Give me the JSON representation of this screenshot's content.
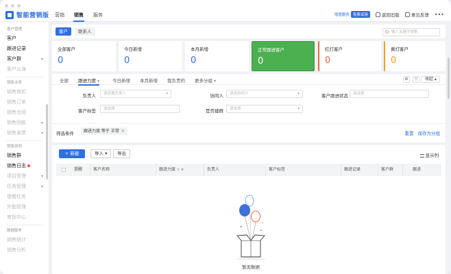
{
  "app": {
    "name": "智能营销版"
  },
  "topnav": {
    "items": [
      {
        "label": "营销"
      },
      {
        "label": "销售"
      },
      {
        "label": "服务"
      }
    ]
  },
  "topright": {
    "version_label": "增值服务",
    "version_badge": "免费试用",
    "switch_label": "返回旧版",
    "feedback_label": "意见反馈",
    "more": "•••"
  },
  "sidebar": {
    "groups": [
      {
        "title": "客户管理",
        "items": [
          {
            "label": "客户",
            "dim": false
          },
          {
            "label": "跟进记录",
            "dim": false
          },
          {
            "label": "客户群",
            "dim": false,
            "chev": true
          },
          {
            "label": "客户公海",
            "dim": true
          }
        ]
      },
      {
        "title": "销售业务",
        "items": [
          {
            "label": "销售商机",
            "dim": true
          },
          {
            "label": "销售订单",
            "dim": true
          },
          {
            "label": "销售合同",
            "dim": true
          },
          {
            "label": "销售回款",
            "dim": true,
            "chev": true
          },
          {
            "label": "销售发票",
            "dim": true,
            "chev": true
          }
        ]
      },
      {
        "title": "销售协同",
        "items": [
          {
            "label": "销售群",
            "dim": false
          },
          {
            "label": "销售日志",
            "dim": false,
            "dot": true
          },
          {
            "label": "项目管理",
            "dim": true,
            "chev": true
          },
          {
            "label": "任务管理",
            "dim": true,
            "chev": true
          },
          {
            "label": "提醒任务",
            "dim": true
          },
          {
            "label": "外勤管理",
            "dim": true
          },
          {
            "label": "审批中心",
            "dim": true
          }
        ]
      },
      {
        "title": "数据服务",
        "items": [
          {
            "label": "销售统计",
            "dim": true
          },
          {
            "label": "销售分析",
            "dim": true
          }
        ]
      }
    ]
  },
  "subtabs": {
    "active": "客户",
    "other": "联系人",
    "search_placeholder": "输入关键字搜索"
  },
  "cards": [
    {
      "label": "全部客户",
      "value": "0"
    },
    {
      "label": "今日新增",
      "value": "0"
    },
    {
      "label": "本月新增",
      "value": "0"
    },
    {
      "label": "正常跟进客户",
      "value": "0"
    },
    {
      "label": "红灯客户",
      "value": "0"
    },
    {
      "label": "黄灯客户",
      "value": "0"
    }
  ],
  "filter_tabs": {
    "items": [
      "全部",
      "跟进力度",
      "今日新增",
      "本月新增",
      "我负责的",
      "更多分组"
    ],
    "collapse": "收起"
  },
  "filters": {
    "owner_label": "负责人",
    "owner_placeholder": "请设置负责人",
    "collab_label": "协同人",
    "collab_placeholder": "请选协同人",
    "status_label": "客户跟进状态",
    "status_placeholder": "请选择",
    "tag_label": "客户标签",
    "tag_placeholder": "请选择",
    "group_label": "是否建群",
    "group_placeholder": "请选择"
  },
  "filter_bar": {
    "label": "筛选条件",
    "chip": "跟进力度 等于 正常",
    "reset": "重置",
    "save": "保存为分组"
  },
  "toolbar": {
    "new": "+ 新建",
    "import": "导入",
    "export": "导出",
    "show_columns": "显示列"
  },
  "table": {
    "columns": [
      "提醒",
      "客户名称",
      "跟进力度",
      "负责人",
      "客户标签",
      "跟进记录",
      "客户群",
      "跟进"
    ],
    "empty_text": "暂无数据"
  },
  "colors": {
    "accent": "#2f6fe4",
    "green": "#4caf50",
    "red": "#e5663a",
    "yellow": "#f0a020"
  }
}
